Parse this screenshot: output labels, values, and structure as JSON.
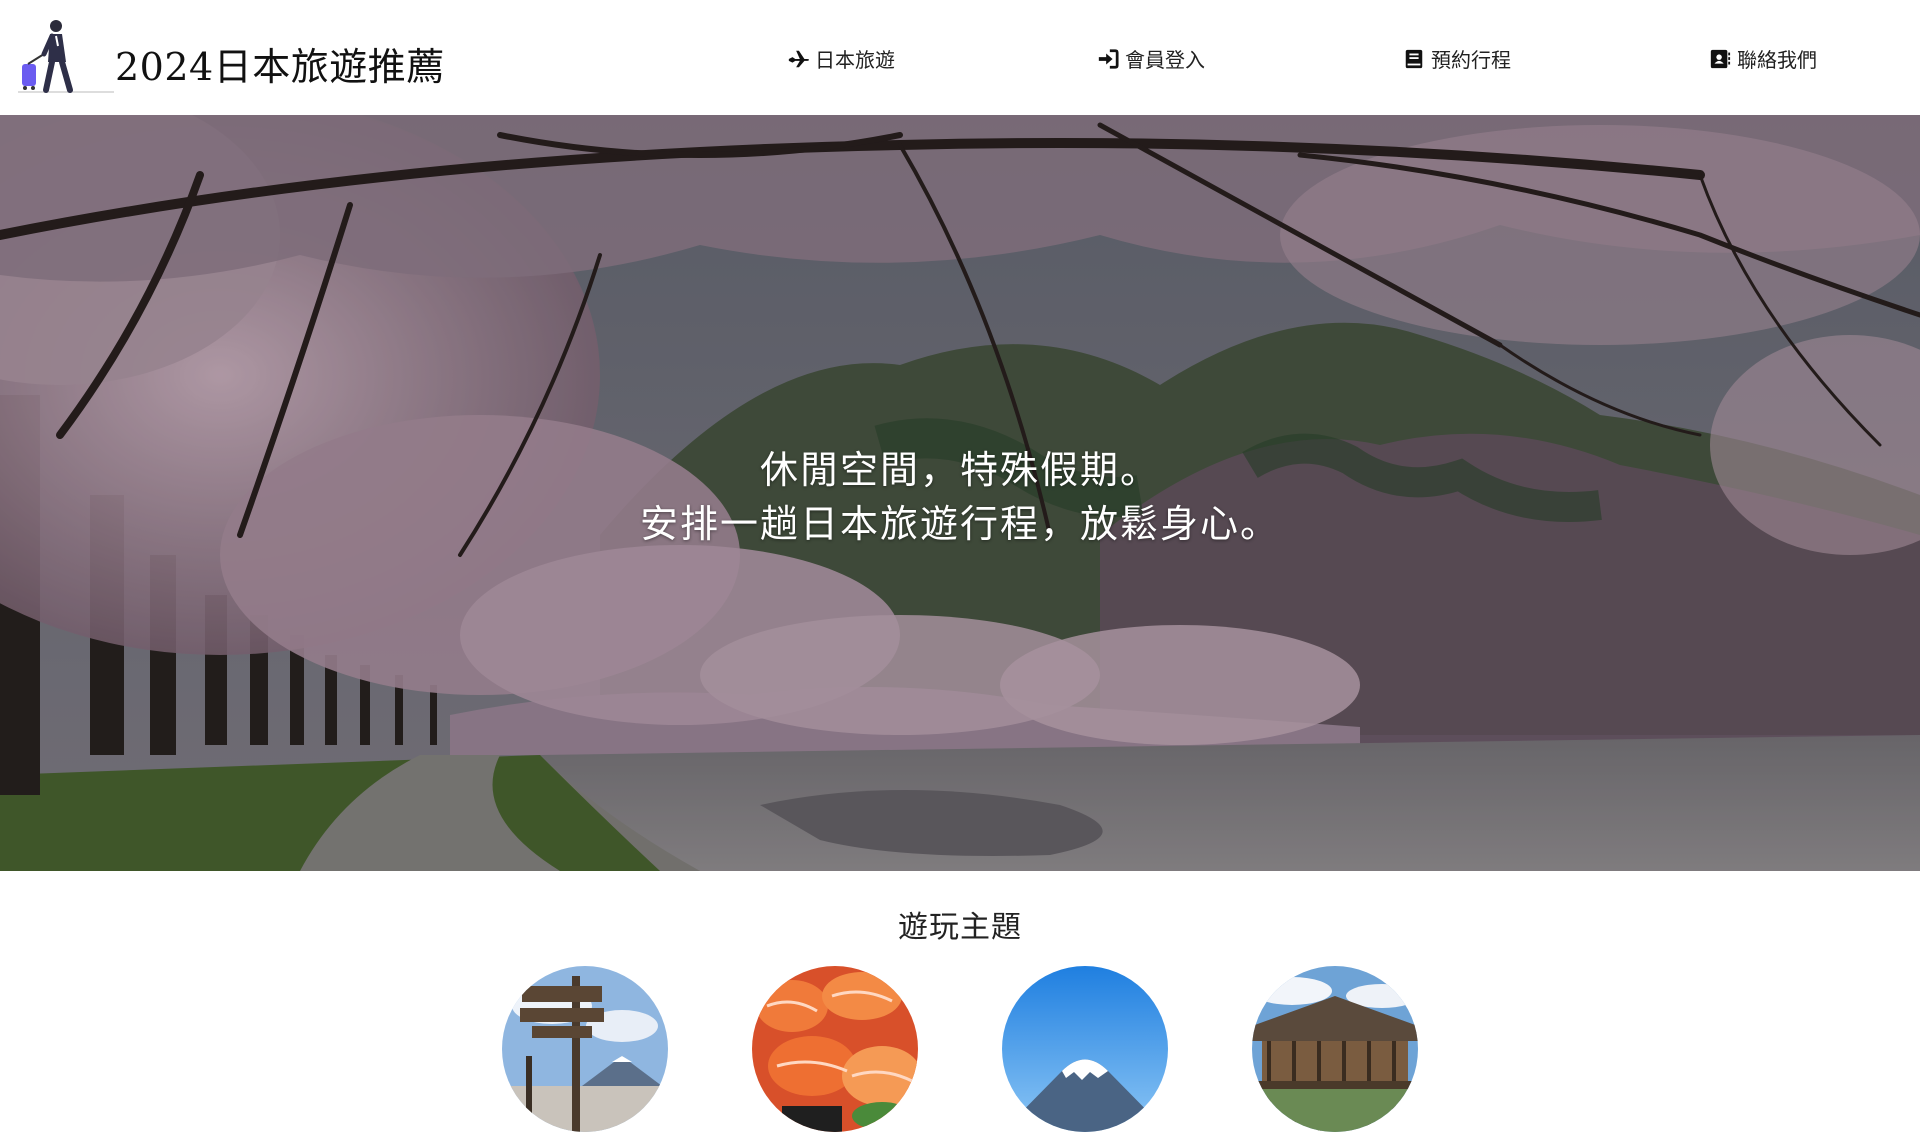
{
  "header": {
    "title": "2024日本旅遊推薦",
    "nav": [
      {
        "label": "日本旅遊",
        "icon": "plane-icon"
      },
      {
        "label": "會員登入",
        "icon": "sign-in-icon"
      },
      {
        "label": "預約行程",
        "icon": "book-icon"
      },
      {
        "label": "聯絡我們",
        "icon": "address-book-icon"
      }
    ]
  },
  "hero": {
    "line1": "休閒空間，特殊假期。",
    "line2": "安排一趟日本旅遊行程，放鬆身心。"
  },
  "themes": {
    "title": "遊玩主題",
    "items": [
      {
        "icon": "signpost-image"
      },
      {
        "icon": "sushi-image"
      },
      {
        "icon": "mount-fuji-image"
      },
      {
        "icon": "temple-image"
      }
    ]
  },
  "colors": {
    "blossom": "#c9a6b8",
    "mountain": "#3e5a3a",
    "sky": "#5d6471"
  }
}
